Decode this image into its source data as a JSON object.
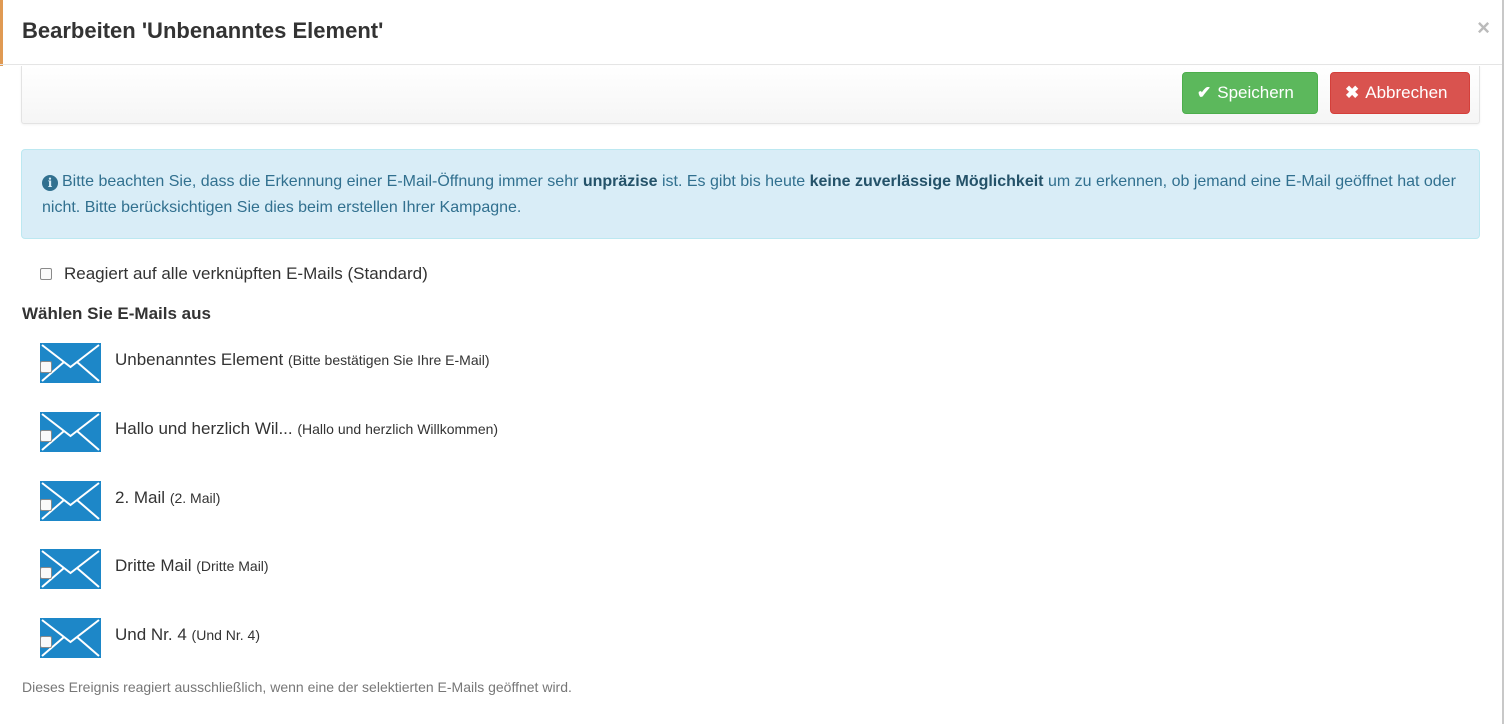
{
  "modal": {
    "title": "Bearbeiten 'Unbenanntes Element'",
    "close_glyph": "×"
  },
  "toolbar": {
    "save_label": "Speichern",
    "save_icon": "check-icon",
    "cancel_label": "Abbrechen",
    "cancel_icon": "times-icon",
    "save_color": "#5cb85c",
    "cancel_color": "#d9534f"
  },
  "alert": {
    "icon": "info-icon",
    "part1": "Bitte beachten Sie, dass die Erkennung einer E-Mail-Öffnung immer sehr ",
    "bold1": "unpräzise",
    "part2": " ist. Es gibt bis heute ",
    "bold2": "keine zuverlässige Möglichkeit",
    "part3": " um zu erkennen, ob jemand eine E-Mail geöffnet hat oder nicht. Bitte berücksichtigen Sie dies beim erstellen Ihrer Kampagne."
  },
  "standard_option": {
    "label": "Reagiert auf alle verknüpften E-Mails (Standard)",
    "checked": false
  },
  "section_title": "Wählen Sie E-Mails aus",
  "mails": [
    {
      "name": "Unbenanntes Element",
      "subject": "(Bitte bestätigen Sie Ihre E-Mail)",
      "checked": false
    },
    {
      "name": "Hallo und herzlich Wil...",
      "subject": "(Hallo und herzlich Willkommen)",
      "checked": false
    },
    {
      "name": "2. Mail",
      "subject": "(2. Mail)",
      "checked": false
    },
    {
      "name": "Dritte Mail",
      "subject": "(Dritte Mail)",
      "checked": false
    },
    {
      "name": "Und Nr. 4",
      "subject": "(Und Nr. 4)",
      "checked": false
    }
  ],
  "footer_note": "Dieses Ereignis reagiert ausschließlich, wenn eine der selektierten E-Mails geöffnet wird.",
  "colors": {
    "envelope": "#1d87c8",
    "alert_bg": "#d9edf7",
    "alert_text": "#31708f"
  }
}
